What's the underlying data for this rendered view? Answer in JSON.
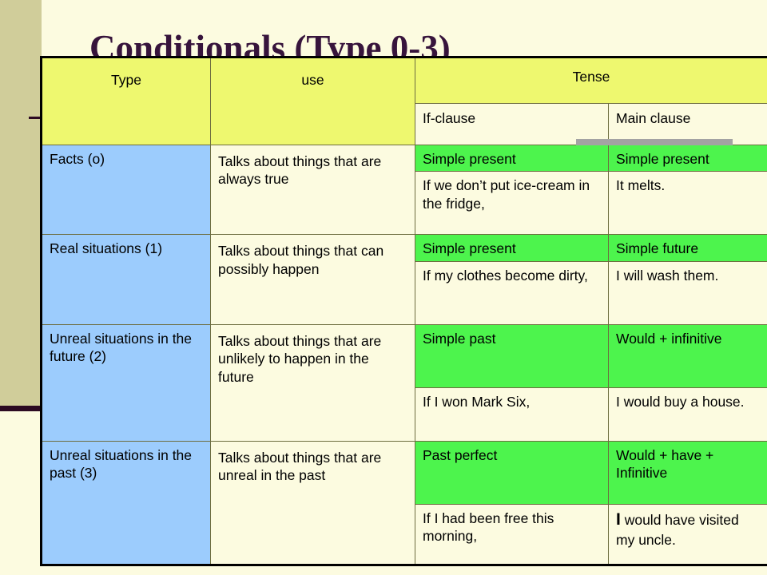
{
  "slide": {
    "title": "Conditionals (Type 0-3)",
    "title_color": "#37143c",
    "background_color": "#fcfbe0",
    "band_color": "#d0cd9a",
    "accent_rule_color": "#2c0a22"
  },
  "palette": {
    "header_yellow": "#eef86f",
    "type_blue": "#9cccfd",
    "tense_green": "#4df44d",
    "cell_cream": "#fcfbe0",
    "underline_gray": "#a3a3a3",
    "border": "#6d6d3f"
  },
  "table": {
    "headers": {
      "type": "Type",
      "use": "use",
      "tense": "Tense",
      "if_clause": "If-clause",
      "main_clause": "Main clause"
    },
    "rows": [
      {
        "type": "Facts (o)",
        "use": "Talks about things that are always true",
        "tense_if": "Simple present",
        "tense_main": "Simple present",
        "example_if": "If we don’t put ice-cream in the fridge,",
        "example_main": "It melts.",
        "example_main_lead": "",
        "example_main_rest": "It melts."
      },
      {
        "type": "Real situations (1)",
        "use": "Talks about things that can possibly happen",
        "tense_if": "Simple present",
        "tense_main": "Simple future",
        "example_if": "If my clothes become dirty,",
        "example_main": "I will wash them.",
        "example_main_lead": "",
        "example_main_rest": "I will wash them."
      },
      {
        "type": "Unreal situations in the future (2)",
        "use": "Talks about things that are unlikely to happen in the future",
        "tense_if": "Simple past",
        "tense_main": "Would + infinitive",
        "example_if": "If I won Mark Six,",
        "example_main": "I would buy a house.",
        "example_main_lead": "",
        "example_main_rest": "I would buy a house."
      },
      {
        "type": "Unreal situations in the past (3)",
        "use": "Talks about things that are unreal in the past",
        "tense_if": "Past perfect",
        "tense_main": "Would + have + Infinitive",
        "example_if": "If I had been free this morning,",
        "example_main": "I would have visited my uncle.",
        "example_main_lead": "I",
        "example_main_rest": " would have visited my uncle."
      }
    ]
  }
}
